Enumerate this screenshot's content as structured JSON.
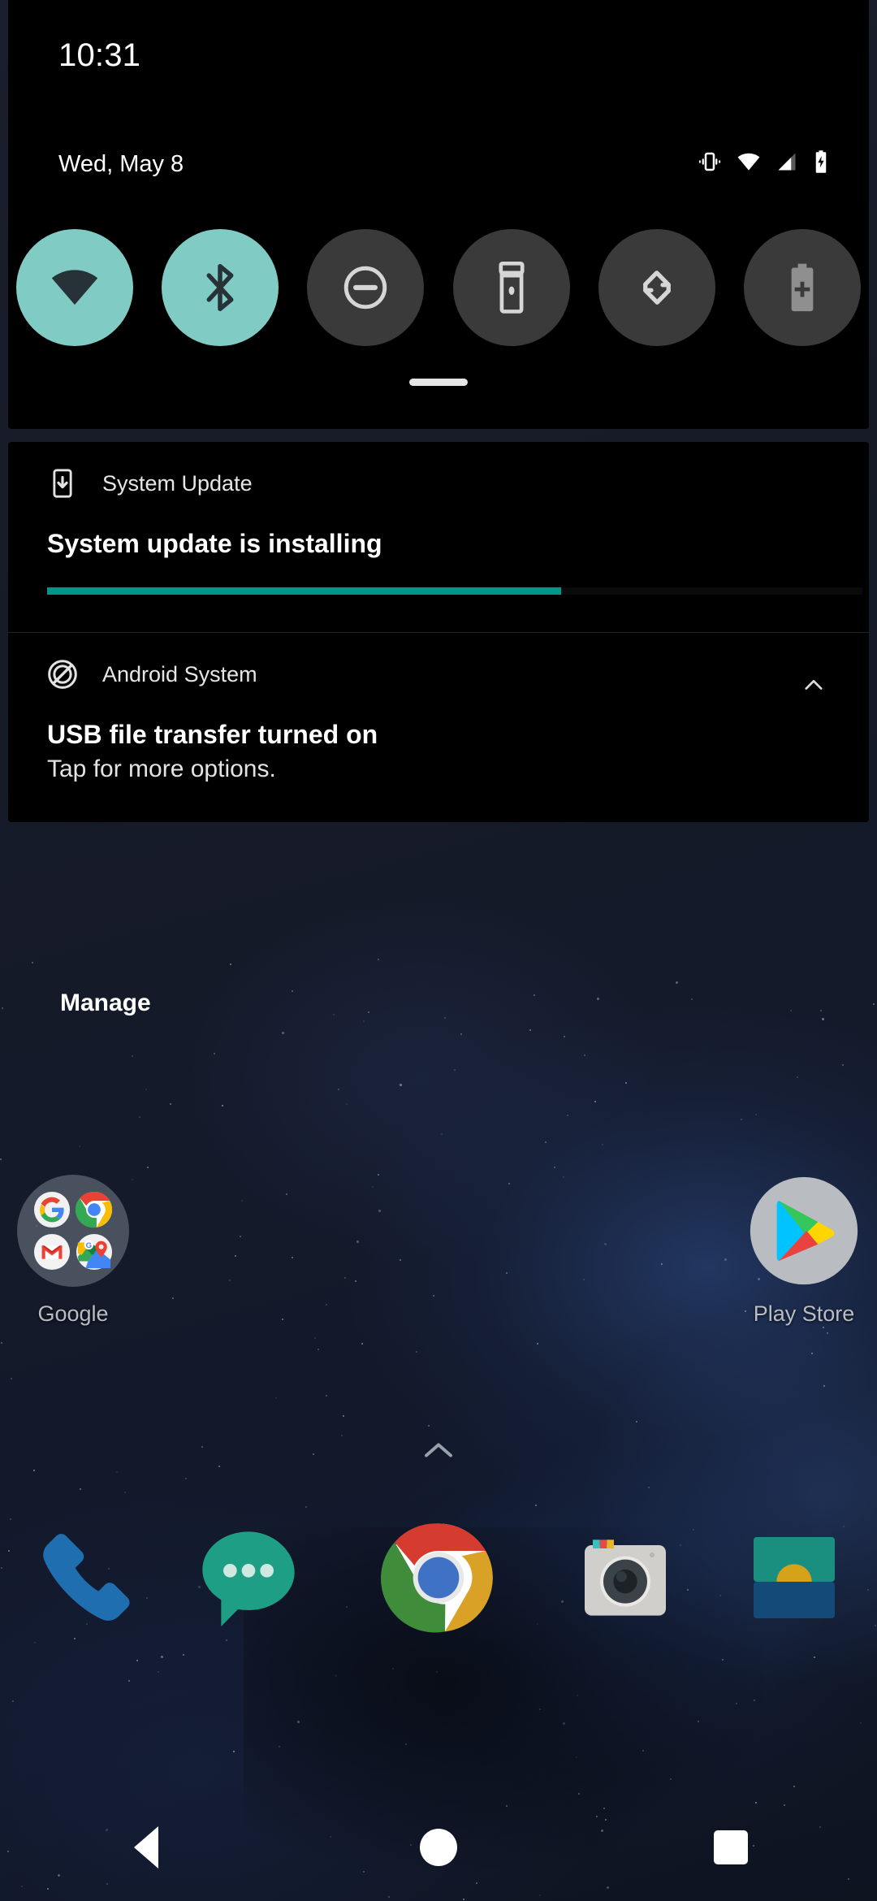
{
  "status_bar": {
    "clock": "10:31",
    "date": "Wed, May 8",
    "icons": [
      {
        "name": "vibrate-icon",
        "label": "Vibrate"
      },
      {
        "name": "wifi-icon",
        "label": "Wi-Fi"
      },
      {
        "name": "cellular-signal-icon",
        "label": "Mobile signal"
      },
      {
        "name": "battery-charging-icon",
        "label": "Battery charging"
      }
    ]
  },
  "quick_settings": {
    "tiles": [
      {
        "id": "wifi",
        "label": "Wi-Fi",
        "icon": "wifi-icon",
        "active": true
      },
      {
        "id": "bluetooth",
        "label": "Bluetooth",
        "icon": "bluetooth-icon",
        "active": true
      },
      {
        "id": "dnd",
        "label": "Do Not Disturb",
        "icon": "do-not-disturb-icon",
        "active": false
      },
      {
        "id": "flashlight",
        "label": "Flashlight",
        "icon": "flashlight-icon",
        "active": false
      },
      {
        "id": "auto_rotate",
        "label": "Auto-rotate",
        "icon": "auto-rotate-icon",
        "active": false
      },
      {
        "id": "battery_saver",
        "label": "Battery Saver",
        "icon": "battery-saver-icon",
        "active": false
      }
    ],
    "active_color": "#80cbc4",
    "inactive_color": "#3a3a3a",
    "handle": "drag-handle"
  },
  "notifications": [
    {
      "app_name": "System Update",
      "app_icon": "system-update-icon",
      "title": "System update is installing",
      "text": "",
      "has_progress": true,
      "progress_percent": 63,
      "progress_color": "#009688",
      "expandable": false
    },
    {
      "app_name": "Android System",
      "app_icon": "android-system-icon",
      "title": "USB file transfer turned on",
      "text": "Tap for more options.",
      "has_progress": false,
      "expandable": true,
      "expand_icon": "chevron-up-icon"
    }
  ],
  "manage_button": {
    "label": "Manage"
  },
  "home_screen": {
    "items": [
      {
        "id": "google_folder",
        "label": "Google",
        "icon": "google-folder-icon",
        "contents": [
          "google-search-icon",
          "chrome-icon",
          "gmail-icon",
          "maps-icon"
        ]
      },
      {
        "id": "play_store",
        "label": "Play Store",
        "icon": "play-store-icon"
      }
    ],
    "app_drawer_handle": "chevron-up-icon"
  },
  "dock": {
    "items": [
      {
        "id": "phone",
        "label": "Phone",
        "icon": "phone-icon"
      },
      {
        "id": "messages",
        "label": "Messages",
        "icon": "messages-icon"
      },
      {
        "id": "chrome",
        "label": "Chrome",
        "icon": "chrome-icon"
      },
      {
        "id": "camera",
        "label": "Camera",
        "icon": "camera-icon"
      },
      {
        "id": "photos",
        "label": "Photos",
        "icon": "gallery-icon"
      }
    ]
  },
  "nav_bar": {
    "buttons": [
      {
        "id": "back",
        "label": "Back",
        "icon": "back-triangle-icon"
      },
      {
        "id": "home",
        "label": "Home",
        "icon": "home-circle-icon"
      },
      {
        "id": "recents",
        "label": "Recents",
        "icon": "recents-square-icon"
      }
    ]
  }
}
